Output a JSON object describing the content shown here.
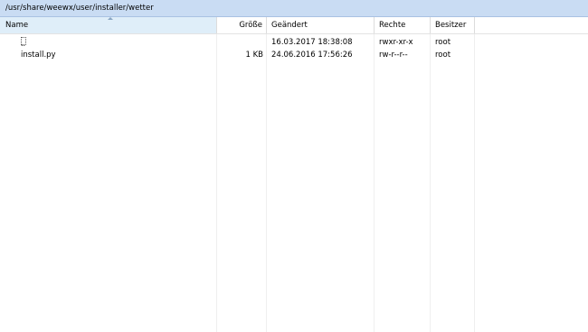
{
  "path": "/usr/share/weewx/user/installer/wetter",
  "columns": {
    "name": "Name",
    "size": "Größe",
    "modified": "Geändert",
    "rights": "Rechte",
    "owner": "Besitzer"
  },
  "rows": [
    {
      "icon": "parent-directory-icon",
      "name": "",
      "size": "",
      "modified": "16.03.2017 18:38:08",
      "rights": "rwxr-xr-x",
      "owner": "root"
    },
    {
      "name": "install.py",
      "size": "1 KB",
      "modified": "24.06.2016 17:56:26",
      "rights": "rw-r--r--",
      "owner": "root"
    }
  ],
  "colors": {
    "path_bar": "#c9dcf3",
    "sorted_header": "#dfeef9"
  }
}
